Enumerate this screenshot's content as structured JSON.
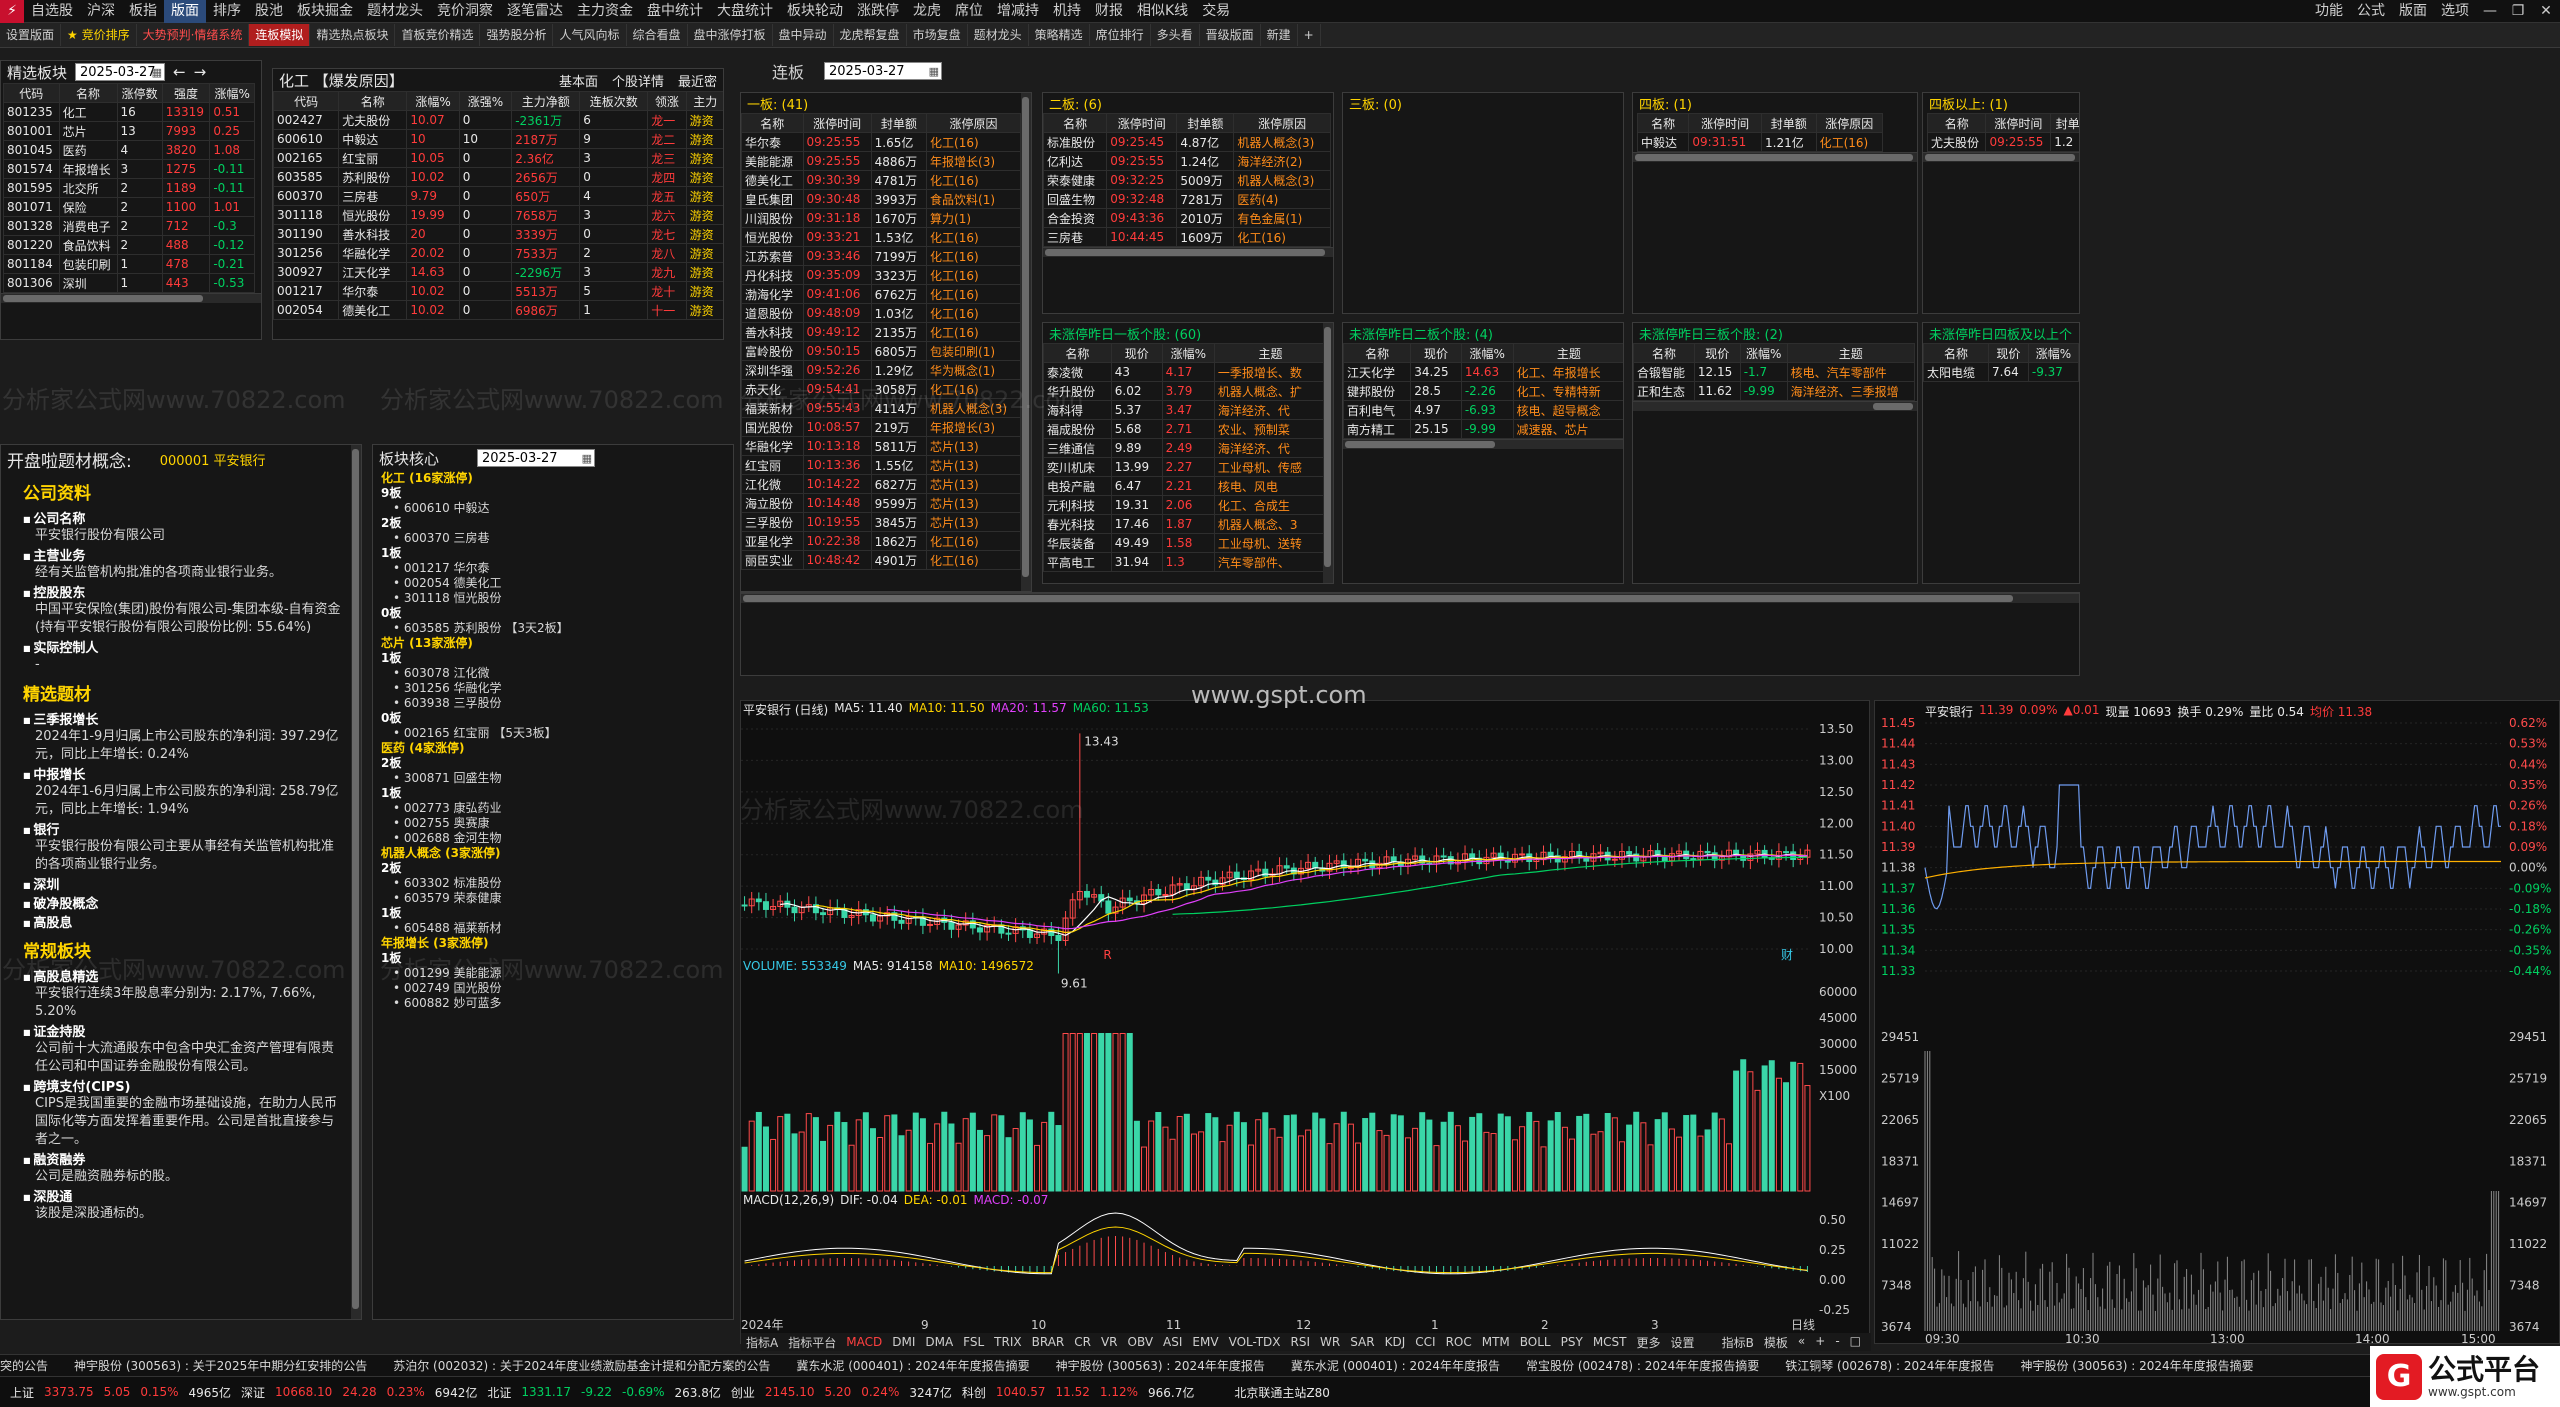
{
  "menu": {
    "items": [
      "自选股",
      "沪深",
      "板指",
      "版面",
      "排序",
      "股池",
      "板块掘金",
      "题材龙头",
      "竞价洞察",
      "逐笔雷达",
      "主力资金",
      "盘中统计",
      "大盘统计",
      "板块轮动",
      "涨跌停",
      "龙虎",
      "席位",
      "增减持",
      "机持",
      "财报",
      "相似K线",
      "交易"
    ],
    "active_index": 3,
    "right_items": [
      "功能",
      "公式",
      "版面",
      "选项"
    ],
    "win_buttons": [
      "—",
      "❐",
      "✕"
    ]
  },
  "toolbar": {
    "items": [
      "设置版面",
      "★ 竞价排序",
      "大势预判·情绪系统",
      "连板模拟",
      "精选热点板块",
      "首板竞价精选",
      "强势股分析",
      "人气风向标",
      "综合看盘",
      "盘中涨停打板",
      "盘中异动",
      "龙虎帮复盘",
      "市场复盘",
      "题材龙头",
      "策略精选",
      "席位排行",
      "多头看",
      "晋级版面",
      "新建",
      "+"
    ]
  },
  "sector": {
    "title": "精选板块",
    "date": "2025-03-27",
    "nav": [
      "←",
      "→"
    ],
    "columns": [
      "代码",
      "名称",
      "涨停数",
      "强度",
      "涨幅%"
    ],
    "rows": [
      [
        "801235",
        "化工",
        "16",
        "13319",
        "0.51"
      ],
      [
        "801001",
        "芯片",
        "13",
        "7993",
        "0.25"
      ],
      [
        "801045",
        "医药",
        "4",
        "3820",
        "1.08"
      ],
      [
        "801574",
        "年报增长",
        "3",
        "1275",
        "-0.11"
      ],
      [
        "801595",
        "北交所",
        "2",
        "1189",
        "-0.11"
      ],
      [
        "801071",
        "保险",
        "2",
        "1100",
        "1.01"
      ],
      [
        "801328",
        "消费电子",
        "2",
        "712",
        "-0.3"
      ],
      [
        "801220",
        "食品饮料",
        "2",
        "488",
        "-0.12"
      ],
      [
        "801184",
        "包装印刷",
        "1",
        "478",
        "-0.21"
      ],
      [
        "801306",
        "深圳",
        "1",
        "443",
        "-0.53"
      ]
    ]
  },
  "detail": {
    "title": "化工 【爆发原因】",
    "tabs": [
      "基本面",
      "个股详情",
      "最近密"
    ],
    "columns": [
      "代码",
      "名称",
      "涨幅%",
      "涨强%",
      "主力净额",
      "连板次数",
      "领涨",
      "主力"
    ],
    "rows": [
      [
        "002427",
        "尤夫股份",
        "10.07",
        "0",
        "-2361万",
        "6",
        "龙一",
        "游资"
      ],
      [
        "600610",
        "中毅达",
        "10",
        "10",
        "2187万",
        "9",
        "龙二",
        "游资"
      ],
      [
        "002165",
        "红宝丽",
        "10.05",
        "0",
        "2.36亿",
        "3",
        "龙三",
        "游资"
      ],
      [
        "603585",
        "苏利股份",
        "10.02",
        "0",
        "2656万",
        "0",
        "龙四",
        "游资"
      ],
      [
        "600370",
        "三房巷",
        "9.79",
        "0",
        "650万",
        "4",
        "龙五",
        "游资"
      ],
      [
        "301118",
        "恒光股份",
        "19.99",
        "0",
        "7658万",
        "3",
        "龙六",
        "游资"
      ],
      [
        "301190",
        "善水科技",
        "20",
        "0",
        "3339万",
        "0",
        "龙七",
        "游资"
      ],
      [
        "301256",
        "华融化学",
        "20.02",
        "0",
        "7533万",
        "2",
        "龙八",
        "游资"
      ],
      [
        "300927",
        "江天化学",
        "14.63",
        "0",
        "-2296万",
        "3",
        "龙九",
        "游资"
      ],
      [
        "001217",
        "华尔泰",
        "10.02",
        "0",
        "5513万",
        "5",
        "龙十",
        "游资"
      ],
      [
        "002054",
        "德美化工",
        "10.02",
        "0",
        "6986万",
        "1",
        "十一",
        "游资"
      ]
    ]
  },
  "lianban": {
    "title": "连板",
    "date": "2025-03-27",
    "b1": {
      "title": "一板: (41)",
      "columns": [
        "名称",
        "涨停时间",
        "封单额",
        "涨停原因"
      ],
      "rows": [
        [
          "华尔泰",
          "09:25:55",
          "1.65亿",
          "化工(16)"
        ],
        [
          "美能能源",
          "09:25:55",
          "4886万",
          "年报增长(3)"
        ],
        [
          "德美化工",
          "09:30:39",
          "4781万",
          "化工(16)"
        ],
        [
          "皇氏集团",
          "09:30:48",
          "3993万",
          "食品饮料(1)"
        ],
        [
          "川润股份",
          "09:31:18",
          "1670万",
          "算力(1)"
        ],
        [
          "恒光股份",
          "09:33:21",
          "1.53亿",
          "化工(16)"
        ],
        [
          "江苏索普",
          "09:33:46",
          "7199万",
          "化工(16)"
        ],
        [
          "丹化科技",
          "09:35:09",
          "3323万",
          "化工(16)"
        ],
        [
          "渤海化学",
          "09:41:06",
          "6762万",
          "化工(16)"
        ],
        [
          "道恩股份",
          "09:48:09",
          "1.03亿",
          "化工(16)"
        ],
        [
          "善水科技",
          "09:49:12",
          "2135万",
          "化工(16)"
        ],
        [
          "富岭股份",
          "09:50:15",
          "6805万",
          "包装印刷(1)"
        ],
        [
          "深圳华强",
          "09:52:26",
          "1.29亿",
          "华为概念(1)"
        ],
        [
          "赤天化",
          "09:54:41",
          "3058万",
          "化工(16)"
        ],
        [
          "福莱新材",
          "09:55:43",
          "4114万",
          "机器人概念(3)"
        ],
        [
          "国光股份",
          "10:08:57",
          "219万",
          "年报增长(3)"
        ],
        [
          "华融化学",
          "10:13:18",
          "5811万",
          "芯片(13)"
        ],
        [
          "红宝丽",
          "10:13:36",
          "1.55亿",
          "芯片(13)"
        ],
        [
          "江化微",
          "10:14:22",
          "6827万",
          "芯片(13)"
        ],
        [
          "海立股份",
          "10:14:48",
          "9599万",
          "芯片(13)"
        ],
        [
          "三孚股份",
          "10:19:55",
          "3845万",
          "芯片(13)"
        ],
        [
          "亚星化学",
          "10:22:38",
          "1862万",
          "化工(16)"
        ],
        [
          "丽臣实业",
          "10:48:42",
          "4901万",
          "化工(16)"
        ]
      ]
    },
    "b2": {
      "title": "二板: (6)",
      "columns": [
        "名称",
        "涨停时间",
        "封单额",
        "涨停原因"
      ],
      "rows": [
        [
          "标准股份",
          "09:25:45",
          "4.87亿",
          "机器人概念(3)"
        ],
        [
          "亿利达",
          "09:25:55",
          "1.24亿",
          "海洋经济(2)"
        ],
        [
          "荣泰健康",
          "09:32:25",
          "5009万",
          "机器人概念(3)"
        ],
        [
          "回盛生物",
          "09:32:48",
          "7281万",
          "医药(4)"
        ],
        [
          "合金投资",
          "09:43:36",
          "2010万",
          "有色金属(1)"
        ],
        [
          "三房巷",
          "10:44:45",
          "1609万",
          "化工(16)"
        ]
      ]
    },
    "b3": {
      "title": "三板: (0)"
    },
    "b4": {
      "title": "四板: (1)",
      "columns": [
        "名称",
        "涨停时间",
        "封单额",
        "涨停原因"
      ],
      "rows": [
        [
          "中毅达",
          "09:31:51",
          "1.21亿",
          "化工(16)"
        ]
      ]
    },
    "b5": {
      "title": "四板以上: (1)",
      "columns": [
        "名称",
        "涨停时间",
        "封单额"
      ],
      "rows": [
        [
          "尤夫股份",
          "09:25:55",
          "1.2"
        ]
      ]
    },
    "u1": {
      "title": "未涨停昨日一板个股: (60)",
      "columns": [
        "名称",
        "现价",
        "涨幅%",
        "主题"
      ],
      "rows": [
        [
          "泰凌微",
          "43",
          "4.17",
          "一季报增长、数"
        ],
        [
          "华升股份",
          "6.02",
          "3.79",
          "机器人概念、扩"
        ],
        [
          "海科得",
          "5.37",
          "3.47",
          "海洋经济、代"
        ],
        [
          "福成股份",
          "5.68",
          "2.71",
          "农业、预制菜"
        ],
        [
          "三维通信",
          "9.89",
          "2.49",
          "海洋经济、代"
        ],
        [
          "奕川机床",
          "13.99",
          "2.27",
          "工业母机、传感"
        ],
        [
          "电投产融",
          "6.47",
          "2.21",
          "核电、风电"
        ],
        [
          "元利科技",
          "19.31",
          "2.06",
          "化工、合成生"
        ],
        [
          "春光科技",
          "17.46",
          "1.87",
          "机器人概念、3"
        ],
        [
          "华辰装备",
          "49.49",
          "1.58",
          "工业母机、送转"
        ],
        [
          "平高电工",
          "31.94",
          "1.3",
          "汽车零部件、"
        ]
      ]
    },
    "u2": {
      "title": "未涨停昨日二板个股: (4)",
      "columns": [
        "名称",
        "现价",
        "涨幅%",
        "主题"
      ],
      "rows": [
        [
          "江天化学",
          "34.25",
          "14.63",
          "化工、年报增长"
        ],
        [
          "键邦股份",
          "28.5",
          "-2.26",
          "化工、专精特新"
        ],
        [
          "百利电气",
          "4.97",
          "-6.93",
          "核电、超导概念"
        ],
        [
          "南方精工",
          "25.15",
          "-9.99",
          "减速器、芯片"
        ]
      ]
    },
    "u3": {
      "title": "未涨停昨日三板个股: (2)",
      "columns": [
        "名称",
        "现价",
        "涨幅%",
        "主题"
      ],
      "rows": [
        [
          "合锻智能",
          "12.15",
          "-1.7",
          "核电、汽车零部件"
        ],
        [
          "正和生态",
          "11.62",
          "-9.99",
          "海洋经济、三季报增"
        ]
      ]
    },
    "u4": {
      "title": "未涨停昨日四板及以上个",
      "columns": [
        "名称",
        "现价",
        "涨幅%"
      ],
      "rows": [
        [
          "太阳电缆",
          "7.64",
          "-9.37"
        ]
      ]
    }
  },
  "profile": {
    "title": "开盘啦题材概念:",
    "code": "000001 平安银行",
    "sections": [
      {
        "h": "公司资料",
        "items": [
          {
            "k": "公司名称",
            "v": "平安银行股份有限公司"
          },
          {
            "k": "主营业务",
            "v": "经有关监管机构批准的各项商业银行业务。"
          },
          {
            "k": "控股股东",
            "v": "中国平安保险(集团)股份有限公司-集团本级-自有资金(持有平安银行股份有限公司股份比例: 55.64%)"
          },
          {
            "k": "实际控制人",
            "v": "-"
          }
        ]
      },
      {
        "h": "精选题材",
        "items": [
          {
            "k": "三季报增长",
            "v": "2024年1-9月归属上市公司股东的净利润: 397.29亿元，同比上年增长: 0.24%"
          },
          {
            "k": "中报增长",
            "v": "2024年1-6月归属上市公司股东的净利润: 258.79亿元，同比上年增长: 1.94%"
          },
          {
            "k": "银行",
            "v": "平安银行股份有限公司主要从事经有关监管机构批准的各项商业银行业务。"
          },
          {
            "k": "深圳",
            "v": ""
          },
          {
            "k": "破净股概念",
            "v": ""
          },
          {
            "k": "高股息",
            "v": ""
          }
        ]
      },
      {
        "h": "常规板块",
        "items": [
          {
            "k": "高股息精选",
            "v": "平安银行连续3年股息率分别为: 2.17%, 7.66%, 5.20%"
          },
          {
            "k": "证金持股",
            "v": "公司前十大流通股东中包含中央汇金资产管理有限责任公司和中国证券金融股份有限公司。"
          },
          {
            "k": "跨境支付(CIPS)",
            "v": "CIPS是我国重要的金融市场基础设施，在助力人民币国际化等方面发挥着重要作用。公司是首批直接参与者之一。"
          },
          {
            "k": "融资融券",
            "v": "公司是融资融券标的股。"
          },
          {
            "k": "深股通",
            "v": "该股是深股通标的。"
          }
        ]
      }
    ]
  },
  "core": {
    "title": "板块核心",
    "date": "2025-03-27",
    "groups": [
      {
        "cat": "化工 (16家涨停)",
        "levels": [
          {
            "l": "9板",
            "s": [
              "600610 中毅达"
            ]
          },
          {
            "l": "2板",
            "s": [
              "600370 三房巷"
            ]
          },
          {
            "l": "1板",
            "s": [
              "001217 华尔泰",
              "002054 德美化工",
              "301118 恒光股份"
            ]
          },
          {
            "l": "0板",
            "s": [
              "603585 苏利股份 【3天2板】"
            ]
          }
        ]
      },
      {
        "cat": "芯片 (13家涨停)",
        "levels": [
          {
            "l": "1板",
            "s": [
              "603078 江化微",
              "301256 华融化学",
              "603938 三孚股份"
            ]
          },
          {
            "l": "0板",
            "s": [
              "002165 红宝丽 【5天3板】"
            ]
          }
        ]
      },
      {
        "cat": "医药 (4家涨停)",
        "levels": [
          {
            "l": "2板",
            "s": [
              "300871 回盛生物"
            ]
          },
          {
            "l": "1板",
            "s": [
              "002773 康弘药业",
              "002755 奥赛康",
              "002688 金河生物"
            ]
          }
        ]
      },
      {
        "cat": "机器人概念 (3家涨停)",
        "levels": [
          {
            "l": "2板",
            "s": [
              "603302 标准股份",
              "603579 荣泰健康"
            ]
          },
          {
            "l": "1板",
            "s": [
              "605488 福莱新材"
            ]
          }
        ]
      },
      {
        "cat": "年报增长 (3家涨停)",
        "levels": [
          {
            "l": "1板",
            "s": [
              "001299 美能能源",
              "002749 国光股份",
              "600882 妙可蓝多"
            ]
          }
        ]
      }
    ]
  },
  "kchart": {
    "header": {
      "name": "平安银行 (日线)",
      "ma5": "MA5: 11.40",
      "ma10": "MA10: 11.50",
      "ma20": "MA20: 11.57",
      "ma60": "MA60: 11.53"
    },
    "high_label": "13.43",
    "low_label": "9.61",
    "y_ticks": [
      "13.50",
      "13.00",
      "12.50",
      "12.00",
      "11.50",
      "11.00",
      "10.50",
      "10.00"
    ],
    "vol_header": {
      "v": "VOLUME: 553349",
      "ma5": "MA5: 914158",
      "ma10": "MA10: 1496572"
    },
    "vol_ticks": [
      "60000",
      "45000",
      "30000",
      "15000",
      "X100"
    ],
    "macd_header": {
      "p": "MACD(12,26,9)",
      "dif": "DIF: -0.04",
      "dea": "DEA: -0.01",
      "macd": "MACD: -0.07"
    },
    "macd_ticks": [
      "0.50",
      "0.25",
      "0.00",
      "-0.25"
    ],
    "x_labels": [
      "2024年",
      "9",
      "10",
      "11",
      "12",
      "1",
      "2",
      "3",
      "日线"
    ],
    "mark_r": "R",
    "mark_cai": "财",
    "indicator_tabs": [
      "指标A",
      "指标平台",
      "MACD",
      "DMI",
      "DMA",
      "FSL",
      "TRIX",
      "BRAR",
      "CR",
      "VR",
      "OBV",
      "ASI",
      "EMV",
      "VOL-TDX",
      "RSI",
      "WR",
      "SAR",
      "KDJ",
      "CCI",
      "ROC",
      "MTM",
      "BOLL",
      "PSY",
      "MCST",
      "更多",
      "设置"
    ],
    "active_tab": "MACD",
    "right_tabs": [
      "指标B",
      "模板",
      "«",
      "+",
      "-",
      "□"
    ],
    "watermark": "www.gspt.com"
  },
  "tchart": {
    "header": {
      "name": "平安银行",
      "price": "11.39",
      "pct": "0.09%",
      "chg": "▲0.01",
      "vol": "现量 10693",
      "turn": "换手 0.29%",
      "lb": "量比 0.54",
      "avg": "均价 11.38"
    },
    "y_left": [
      "11.45",
      "11.44",
      "11.43",
      "11.42",
      "11.41",
      "11.40",
      "11.39",
      "11.38",
      "11.37",
      "11.36",
      "11.35",
      "11.34",
      "11.33"
    ],
    "y_right": [
      "0.62%",
      "0.53%",
      "0.44%",
      "0.35%",
      "0.26%",
      "0.18%",
      "0.09%",
      "0.00%",
      "-0.09%",
      "-0.18%",
      "-0.26%",
      "-0.35%",
      "-0.44%"
    ],
    "vol_ticks": [
      "29451",
      "25719",
      "22065",
      "18371",
      "14697",
      "11022",
      "7348",
      "3674"
    ],
    "x_labels": [
      "09:30",
      "10:30",
      "13:00",
      "14:00",
      "15:00"
    ]
  },
  "ticker": [
    "突的公告",
    "神宇股份 (300563) : 关于2025年中期分红安排的公告",
    "苏泊尔 (002032) : 关于2024年度业绩激励基金计提和分配方案的公告",
    "冀东水泥 (000401) : 2024年年度报告摘要",
    "神宇股份 (300563) : 2024年年度报告",
    "冀东水泥 (000401) : 2024年年度报告",
    "常宝股份 (002478) : 2024年年度报告摘要",
    "铁江铜琴 (002678) : 2024年年度报告",
    "神宇股份 (300563) : 2024年年度报告摘要"
  ],
  "status": {
    "items": [
      {
        "n": "上证",
        "v": "3373.75",
        "c": "5.05",
        "p": "0.15%",
        "a": "4965亿"
      },
      {
        "n": "深证",
        "v": "10668.10",
        "c": "24.28",
        "p": "0.23%",
        "a": "6942亿"
      },
      {
        "n": "北证",
        "v": "1331.17",
        "c": "-9.22",
        "p": "-0.69%",
        "a": "263.8亿"
      },
      {
        "n": "创业",
        "v": "2145.10",
        "c": "5.20",
        "p": "0.24%",
        "a": "3247亿"
      },
      {
        "n": "科创",
        "v": "1040.57",
        "c": "11.52",
        "p": "1.12%",
        "a": "966.7亿"
      }
    ],
    "server": "北京联通主站Z80"
  },
  "brand": {
    "icon": "G",
    "name": "公式平台",
    "url": "www.gspt.com"
  },
  "watermark_text": "分析家公式网www.70822.com",
  "colors": {
    "up": "#ff3b3b",
    "down": "#00d060",
    "accent": "#ffd400",
    "menu_active": "#2b4a7a",
    "brand_red": "#e31b23"
  }
}
